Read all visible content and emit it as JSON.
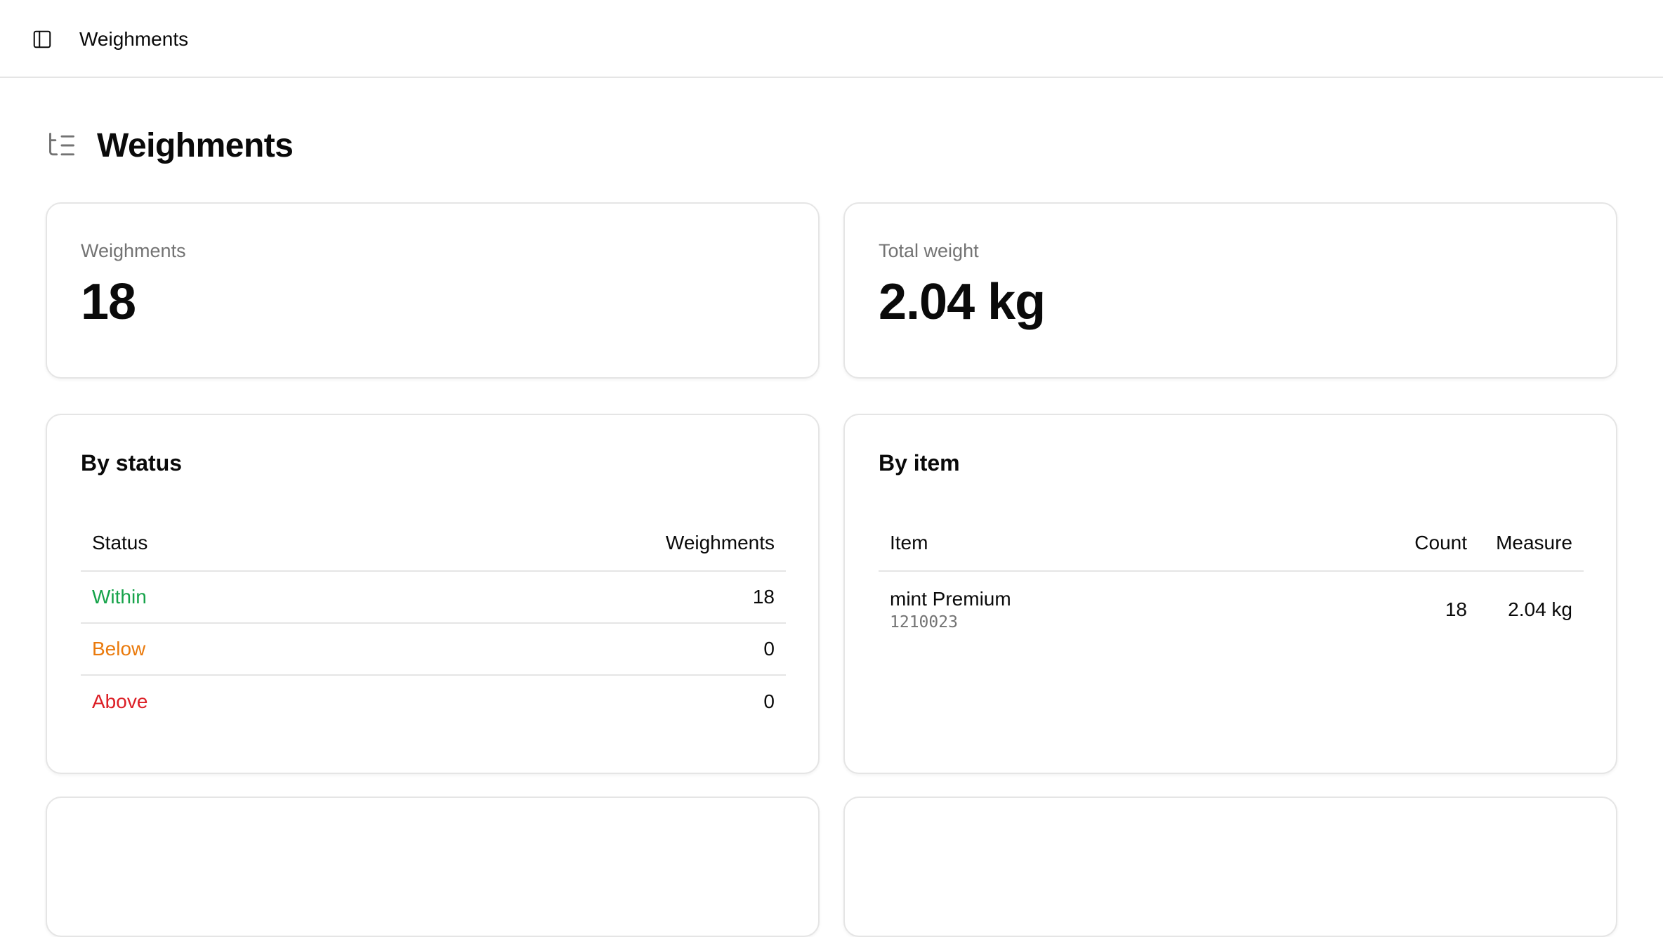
{
  "topbar": {
    "title": "Weighments"
  },
  "page": {
    "title": "Weighments"
  },
  "stats": {
    "weighments": {
      "label": "Weighments",
      "value": "18"
    },
    "total_weight": {
      "label": "Total weight",
      "value": "2.04 kg"
    }
  },
  "by_status": {
    "title": "By status",
    "headers": {
      "status": "Status",
      "weighments": "Weighments"
    },
    "rows": [
      {
        "status": "Within",
        "count": "18",
        "color": "#16a34a"
      },
      {
        "status": "Below",
        "count": "0",
        "color": "#ea7a0c"
      },
      {
        "status": "Above",
        "count": "0",
        "color": "#dc1f26"
      }
    ]
  },
  "by_item": {
    "title": "By item",
    "headers": {
      "item": "Item",
      "count": "Count",
      "measure": "Measure"
    },
    "rows": [
      {
        "name": "mint Premium",
        "code": "1210023",
        "count": "18",
        "measure": "2.04 kg"
      }
    ]
  },
  "icons": {
    "sidebar_toggle": "panel-left-icon",
    "page": "list-tree-icon"
  }
}
